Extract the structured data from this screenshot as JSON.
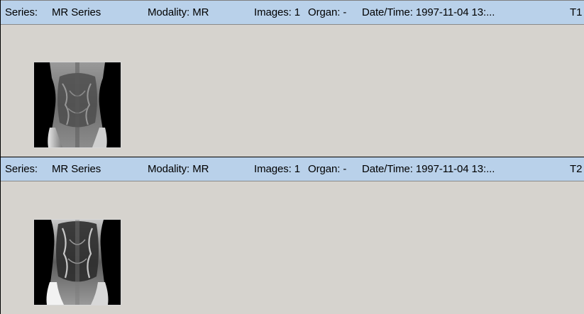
{
  "series_list": [
    {
      "header": {
        "series_label": "Series:",
        "series_name": "MR Series",
        "modality": "Modality: MR",
        "images": "Images: 1",
        "organ": "Organ: -",
        "datetime": "Date/Time: 1997-11-04 13:...",
        "tag": "T1"
      }
    },
    {
      "header": {
        "series_label": "Series:",
        "series_name": "MR Series",
        "modality": "Modality: MR",
        "images": "Images: 1",
        "organ": "Organ: -",
        "datetime": "Date/Time: 1997-11-04 13:...",
        "tag": "T2"
      }
    }
  ],
  "colors": {
    "header_bg": "#b9d1ea",
    "panel_bg": "#d6d3ce",
    "thumbnail_bg": "#000000"
  }
}
